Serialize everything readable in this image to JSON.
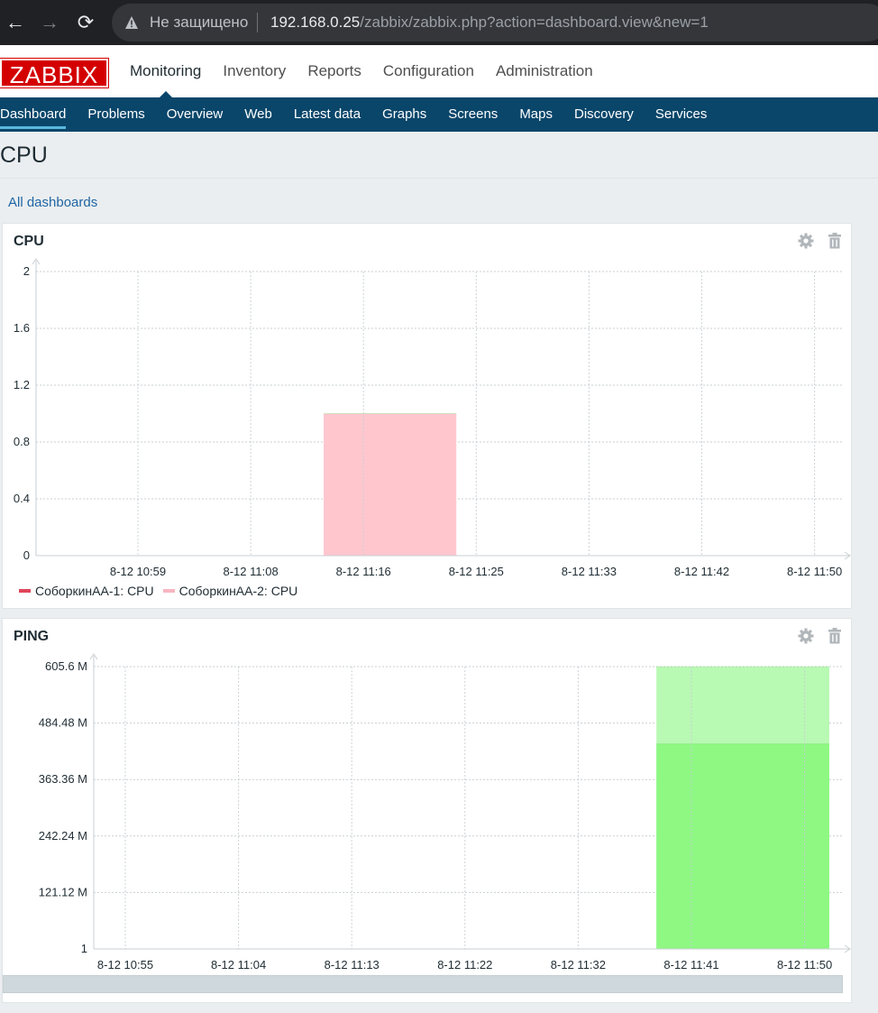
{
  "browser": {
    "back_icon": "←",
    "forward_icon": "→",
    "reload_icon": "⟳",
    "insecure_label": "Не защищено",
    "url_host": "192.168.0.25",
    "url_path": "/zabbix/zabbix.php?action=dashboard.view&new=1"
  },
  "header": {
    "logo": "ZABBIX",
    "main_menu": [
      "Monitoring",
      "Inventory",
      "Reports",
      "Configuration",
      "Administration"
    ],
    "active_main": "Monitoring",
    "sub_menu": [
      "Dashboard",
      "Problems",
      "Overview",
      "Web",
      "Latest data",
      "Graphs",
      "Screens",
      "Maps",
      "Discovery",
      "Services"
    ],
    "active_sub": "Dashboard"
  },
  "page": {
    "title": "CPU",
    "all_dashboards_link": "All dashboards"
  },
  "widgets": [
    {
      "title": "CPU",
      "gear_icon": "gear-icon",
      "trash_icon": "trash-icon",
      "legend": [
        {
          "label": "СоборкинАА-1: CPU",
          "color": "#e0455a"
        },
        {
          "label": "СоборкинАА-2: CPU",
          "color": "#f7b6c1"
        }
      ]
    },
    {
      "title": "PING",
      "gear_icon": "gear-icon",
      "trash_icon": "trash-icon"
    }
  ],
  "chart_data": [
    {
      "type": "area",
      "title": "CPU",
      "y_ticks": [
        "0",
        "0.4",
        "0.8",
        "1.2",
        "1.6",
        "2"
      ],
      "ylim": [
        0,
        2
      ],
      "x_ticks": [
        "8-12 10:59",
        "8-12 11:08",
        "8-12 11:16",
        "8-12 11:25",
        "8-12 11:33",
        "8-12 11:42",
        "8-12 11:50"
      ],
      "grid": true,
      "series": [
        {
          "name": "СоборкинАА-1: CPU",
          "color": "#e0455a",
          "start": "8-12 11:13",
          "end": "8-12 11:23",
          "value": 0
        },
        {
          "name": "СоборкинАА-2: CPU",
          "color": "#ffc6ce",
          "start": "8-12 11:13",
          "end": "8-12 11:23",
          "value": 1
        }
      ]
    },
    {
      "type": "area",
      "title": "PING",
      "y_ticks": [
        "1",
        "121.12 M",
        "242.24 M",
        "363.36 M",
        "484.48 M",
        "605.6 M"
      ],
      "ylim": [
        1,
        605600000
      ],
      "x_ticks": [
        "8-12 10:55",
        "8-12 11:04",
        "8-12 11:13",
        "8-12 11:22",
        "8-12 11:32",
        "8-12 11:41",
        "8-12 11:50"
      ],
      "grid": true,
      "series": [
        {
          "color": "#b8f9b3",
          "start": "8-12 11:38",
          "end": "8-12 11:52",
          "value": 605000000
        },
        {
          "color": "#8ef883",
          "start": "8-12 11:38",
          "end": "8-12 11:52",
          "value": 440000000
        }
      ]
    }
  ]
}
